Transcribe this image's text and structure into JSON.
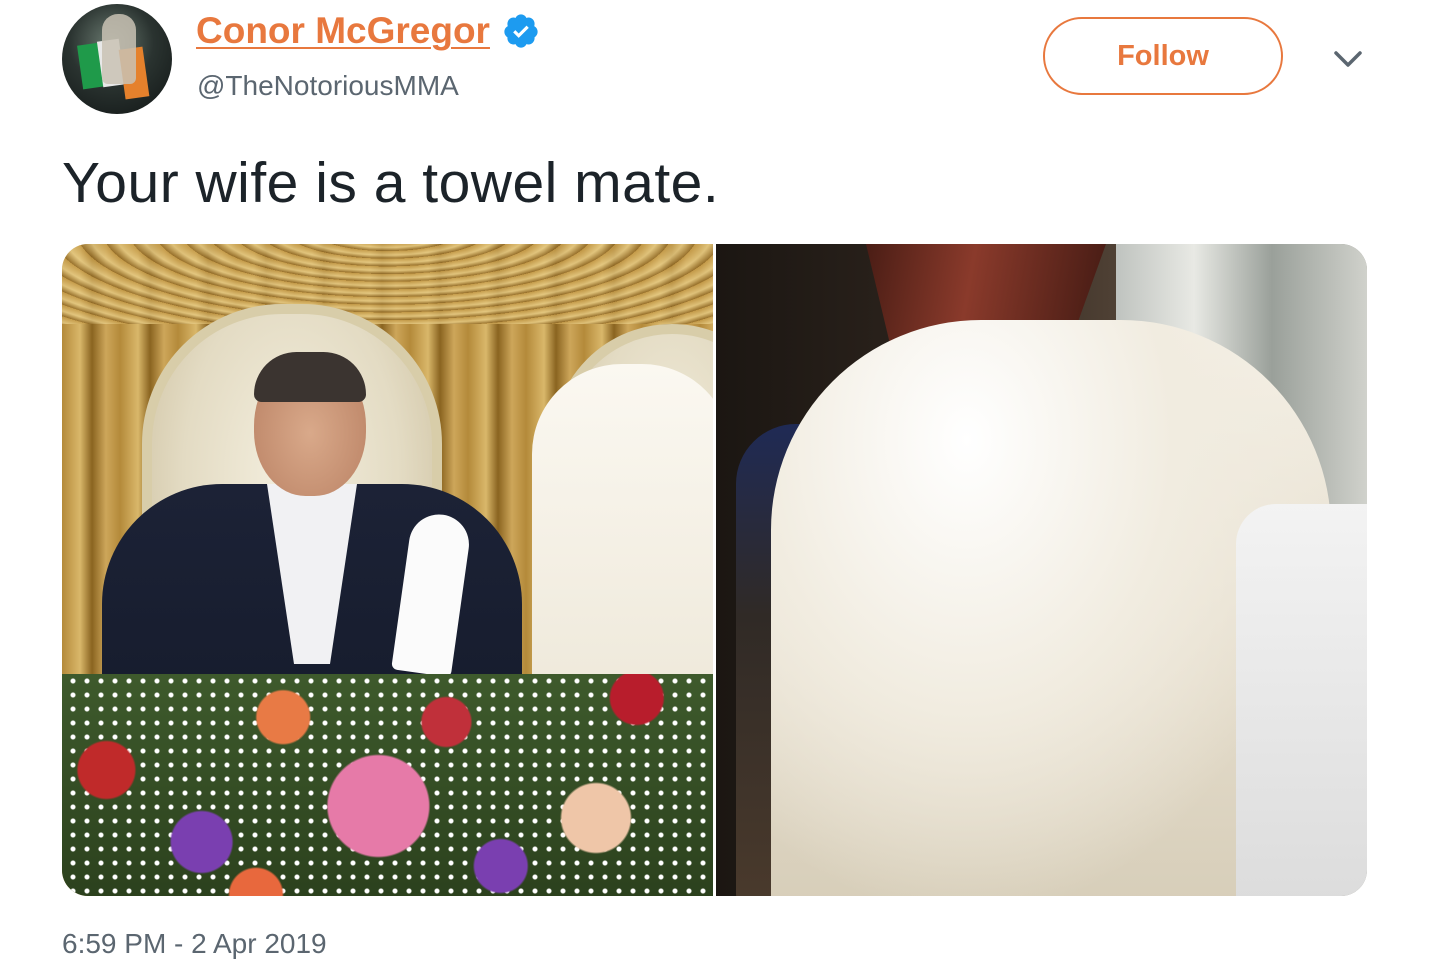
{
  "author": {
    "name": "Conor McGregor",
    "handle": "@TheNotoriousMMA",
    "verified": true,
    "avatar_icon": "profile-photo"
  },
  "actions": {
    "follow_label": "Follow",
    "more_icon": "chevron-down-icon"
  },
  "tweet": {
    "text": "Your wife is a towel mate.",
    "media_count": 2,
    "timestamp": "6:59 PM - 2 Apr 2019"
  },
  "colors": {
    "accent": "#e8783e",
    "verified_badge": "#1d9bf0",
    "secondary_text": "#5b6670",
    "primary_text": "#1c2329"
  }
}
